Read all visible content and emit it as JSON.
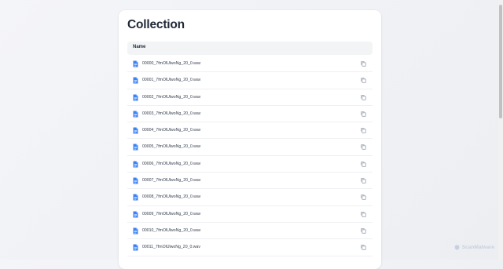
{
  "page_title": "Collection",
  "table": {
    "header_name": "Name"
  },
  "files": [
    {
      "name": "00000_7fmOlUlwoNg_20_0.wav"
    },
    {
      "name": "00001_7fmOlUlwoNg_20_0.wav"
    },
    {
      "name": "00002_7fmOlUlwoNg_20_0.wav"
    },
    {
      "name": "00003_7fmOlUlwoNg_20_0.wav"
    },
    {
      "name": "00004_7fmOlUlwoNg_20_0.wav"
    },
    {
      "name": "00005_7fmOlUlwoNg_20_0.wav"
    },
    {
      "name": "00006_7fmOlUlwoNg_20_0.wav"
    },
    {
      "name": "00007_7fmOlUlwoNg_20_0.wav"
    },
    {
      "name": "00008_7fmOlUlwoNg_20_0.wav"
    },
    {
      "name": "00009_7fmOlUlwoNg_20_0.wav"
    },
    {
      "name": "00010_7fmOlUlwoNg_20_0.wav"
    },
    {
      "name": "00011_7fmOlUlwoNg_20_0.wav"
    }
  ],
  "icons": {
    "file": "file-icon",
    "copy": "copy-icon"
  },
  "colors": {
    "file_icon": "#3b82f6",
    "copy_icon": "#9ca3af"
  },
  "watermark": "ScanMalware"
}
